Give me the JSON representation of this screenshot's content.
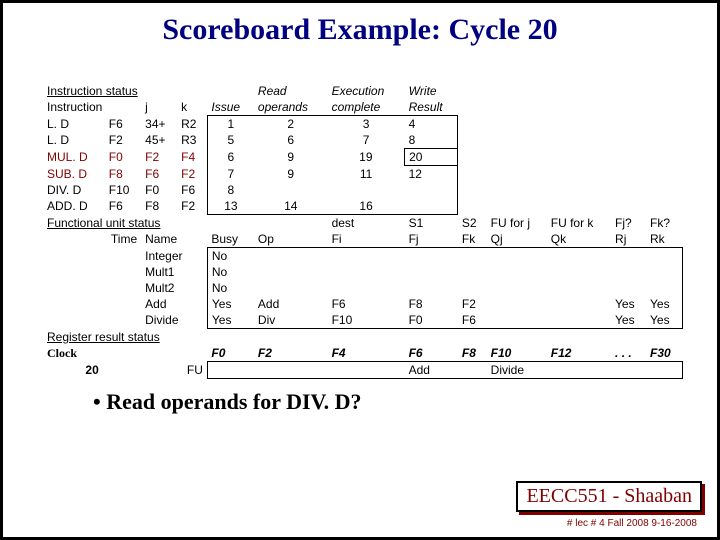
{
  "title": "Scoreboard Example:  Cycle 20",
  "instr_status_label": "Instruction status",
  "hdr": {
    "instruction": "Instruction",
    "j": "j",
    "k": "k",
    "issue": "Issue",
    "read": "Read",
    "operands": "operands",
    "execution": "Execution",
    "complete": "complete",
    "write": "Write",
    "result": "Result"
  },
  "rows": [
    {
      "op": "L. D",
      "dst": "F6",
      "j": "34+",
      "k": "R2",
      "issue": "1",
      "read": "2",
      "exec": "3",
      "write": "4"
    },
    {
      "op": "L. D",
      "dst": "F2",
      "j": "45+",
      "k": "R3",
      "issue": "5",
      "read": "6",
      "exec": "7",
      "write": "8"
    },
    {
      "op": "MUL. D",
      "dst": "F0",
      "j": "F2",
      "k": "F4",
      "issue": "6",
      "read": "9",
      "exec": "19",
      "write": "20",
      "hl": true,
      "box": true
    },
    {
      "op": "SUB. D",
      "dst": "F8",
      "j": "F6",
      "k": "F2",
      "issue": "7",
      "read": "9",
      "exec": "11",
      "write": "12",
      "hl": true
    },
    {
      "op": "DIV. D",
      "dst": "F10",
      "j": "F0",
      "k": "F6",
      "issue": "8",
      "read": "",
      "exec": "",
      "write": ""
    },
    {
      "op": "ADD. D",
      "dst": "F6",
      "j": "F8",
      "k": "F2",
      "issue": "13",
      "read": "14",
      "exec": "16",
      "write": ""
    }
  ],
  "fu_label": "Functional unit status",
  "fu_hdr": {
    "time": "Time",
    "name": "Name",
    "busy": "Busy",
    "op": "Op",
    "dest": "dest",
    "fi": "Fi",
    "s1": "S1",
    "fj": "Fj",
    "s2": "S2",
    "fk": "Fk",
    "fuj": "FU for j",
    "qj": "Qj",
    "fuk": "FU for k",
    "qk": "Qk",
    "fjq": "Fj?",
    "rj": "Rj",
    "fkq": "Fk?",
    "rk": "Rk"
  },
  "fu_rows": [
    {
      "name": "Integer",
      "busy": "No"
    },
    {
      "name": "Mult1",
      "busy": "No"
    },
    {
      "name": "Mult2",
      "busy": "No"
    },
    {
      "name": "Add",
      "busy": "Yes",
      "op": "Add",
      "fi": "F6",
      "fj": "F8",
      "fk": "F2",
      "rj": "Yes",
      "rk": "Yes"
    },
    {
      "name": "Divide",
      "busy": "Yes",
      "op": "Div",
      "fi": "F10",
      "fj": "F0",
      "fk": "F6",
      "rj": "Yes",
      "rk": "Yes"
    }
  ],
  "reg_label": "Register result status",
  "clock_label": "Clock",
  "clock_val": "20",
  "fu_short": "FU",
  "regs": [
    "F0",
    "F2",
    "F4",
    "F6",
    "F8",
    "F10",
    "F12",
    ". . .",
    "F30"
  ],
  "reg_vals": [
    "",
    "",
    "",
    "Add",
    "",
    "Divide",
    "",
    "",
    ""
  ],
  "bullet": "• Read operands for DIV. D?",
  "footer": "EECC551 - Shaaban",
  "subfooter": "#  lec # 4  Fall 2008   9-16-2008"
}
